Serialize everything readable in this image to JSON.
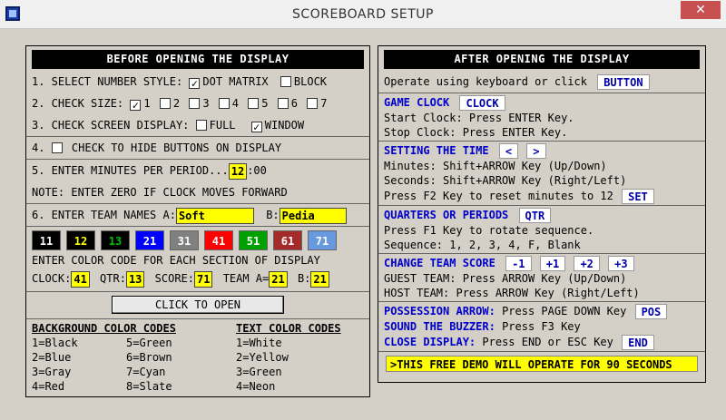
{
  "window": {
    "title": "SCOREBOARD SETUP",
    "close_label": "✕"
  },
  "left": {
    "header": "BEFORE OPENING THE DISPLAY",
    "number_style": {
      "label": "1. SELECT NUMBER STYLE:",
      "opt1": "DOT MATRIX",
      "opt2": "BLOCK"
    },
    "size": {
      "label": "2. CHECK SIZE:",
      "opts": [
        "1",
        "2",
        "3",
        "4",
        "5",
        "6",
        "7"
      ]
    },
    "screen": {
      "label": "3. CHECK SCREEN DISPLAY:",
      "opt1": "FULL",
      "opt2": "WINDOW"
    },
    "hide": {
      "label": "4.",
      "text": "CHECK TO HIDE BUTTONS ON DISPLAY"
    },
    "minutes": {
      "label": "5. ENTER MINUTES PER PERIOD...",
      "value": "12",
      "suffix": ":00"
    },
    "note": "NOTE: ENTER ZERO IF CLOCK MOVES FORWARD",
    "teams": {
      "label": "6. ENTER TEAM NAMES A:",
      "a_value": "Soft",
      "b_label": "B:",
      "b_value": "Pedia"
    },
    "swatches": [
      {
        "n": "11",
        "bg": "#000000",
        "fg": "#ffffff"
      },
      {
        "n": "12",
        "bg": "#000000",
        "fg": "#ffff00"
      },
      {
        "n": "13",
        "bg": "#000000",
        "fg": "#00c000"
      },
      {
        "n": "21",
        "bg": "#0000ff",
        "fg": "#ffffff"
      },
      {
        "n": "31",
        "bg": "#808080",
        "fg": "#ffffff"
      },
      {
        "n": "41",
        "bg": "#ff0000",
        "fg": "#ffffff"
      },
      {
        "n": "51",
        "bg": "#00a000",
        "fg": "#ffffff"
      },
      {
        "n": "61",
        "bg": "#a52a2a",
        "fg": "#ffffff"
      },
      {
        "n": "71",
        "bg": "#6699dd",
        "fg": "#ffffff"
      }
    ],
    "color_prompt": "ENTER COLOR CODE FOR EACH SECTION OF DISPLAY",
    "color_fields": {
      "clock_label": "CLOCK:",
      "clock": "41",
      "qtr_label": "QTR:",
      "qtr": "13",
      "score_label": "SCORE:",
      "score": "71",
      "team_a_label": "TEAM A=",
      "team_a": "21",
      "b_label": "B:",
      "b": "21"
    },
    "click_to_open": "CLICK TO OPEN",
    "bg_codes": {
      "title": "BACKGROUND COLOR CODES",
      "col1": [
        "1=Black",
        "2=Blue",
        "3=Gray",
        "4=Red"
      ],
      "col2": [
        "5=Green",
        "6=Brown",
        "7=Cyan",
        "8=Slate"
      ]
    },
    "text_codes": {
      "title": "TEXT COLOR CODES",
      "items": [
        "1=White",
        "2=Yellow",
        "3=Green",
        "4=Neon"
      ]
    }
  },
  "right": {
    "header": "AFTER OPENING THE DISPLAY",
    "operate": {
      "text": "Operate using keyboard or click",
      "button": "BUTTON"
    },
    "game_clock": {
      "title": "GAME CLOCK",
      "button": "CLOCK",
      "line1": "Start Clock: Press ENTER Key.",
      "line2": "Stop Clock: Press ENTER Key."
    },
    "setting_time": {
      "title": "SETTING THE TIME",
      "btn_left": "<",
      "btn_right": ">",
      "line1": "Minutes: Shift+ARROW Key (Up/Down)",
      "line2": "Seconds: Shift+ARROW Key (Right/Left)",
      "line3": "Press F2 Key to reset minutes to 12",
      "set": "SET"
    },
    "quarters": {
      "title": "QUARTERS OR PERIODS",
      "button": "QTR",
      "line1": "Press F1 Key to rotate sequence.",
      "line2": "Sequence: 1, 2, 3, 4, F, Blank"
    },
    "team_score": {
      "title": "CHANGE TEAM SCORE",
      "btns": [
        "-1",
        "+1",
        "+2",
        "+3"
      ],
      "line1": "GUEST TEAM: Press ARROW Key (Up/Down)",
      "line2": "HOST TEAM: Press ARROW Key (Right/Left)"
    },
    "possession": {
      "title": "POSSESSION ARROW:",
      "text": "Press PAGE DOWN Key",
      "button": "POS"
    },
    "buzzer": {
      "title": "SOUND THE BUZZER:",
      "text": "Press F3 Key"
    },
    "close": {
      "title": "CLOSE DISPLAY:",
      "text": "Press END or ESC Key",
      "button": "END"
    },
    "demo": ">THIS FREE DEMO WILL OPERATE FOR 90 SECONDS"
  }
}
